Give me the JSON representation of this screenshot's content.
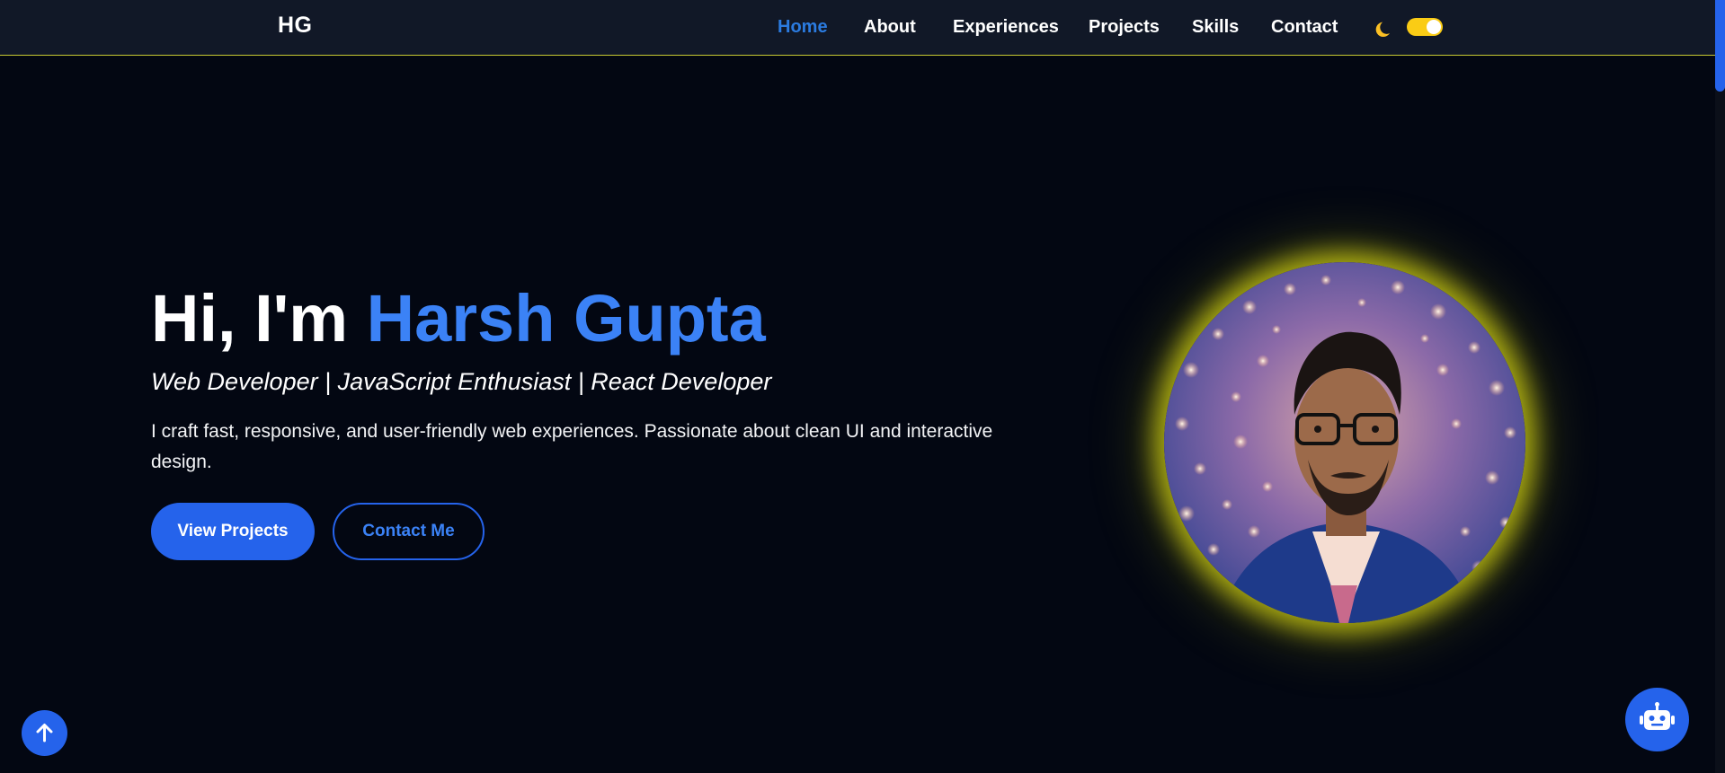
{
  "nav": {
    "brand": "HG",
    "links": [
      {
        "label": "Home",
        "active": true
      },
      {
        "label": "About",
        "active": false
      },
      {
        "label": "Experiences",
        "active": false
      },
      {
        "label": "Projects",
        "active": false
      },
      {
        "label": "Skills",
        "active": false
      },
      {
        "label": "Contact",
        "active": false
      }
    ],
    "theme_icon": "moon-icon",
    "theme_toggle_on": true
  },
  "hero": {
    "greeting": "Hi, I'm",
    "name": "Harsh Gupta",
    "subtitle": "Web Developer | JavaScript Enthusiast | React Developer",
    "description": "I craft fast, responsive, and user-friendly web experiences. Passionate about clean UI and interactive design.",
    "primary_button": "View Projects",
    "secondary_button": "Contact Me",
    "portrait_icon": "profile-photo"
  },
  "floating": {
    "scroll_top_icon": "arrow-up-icon",
    "chatbot_icon": "robot-icon"
  },
  "colors": {
    "background": "#030712",
    "navbar": "#111827",
    "accent": "#3b82f6",
    "button": "#2563eb",
    "glow": "#d2d214",
    "toggle": "#facc15"
  }
}
